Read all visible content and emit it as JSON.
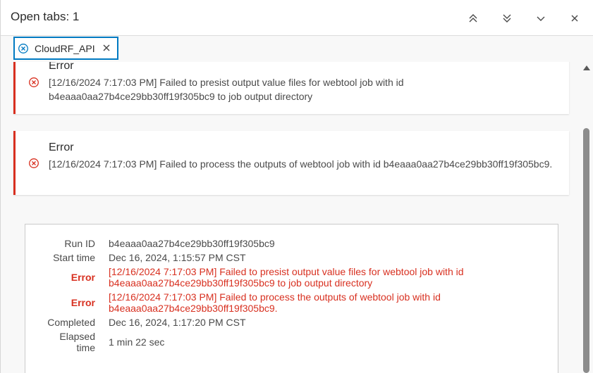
{
  "header": {
    "title": "Open tabs: 1",
    "buttons": [
      "collapse-all",
      "expand-all",
      "collapse",
      "close"
    ]
  },
  "tabs": [
    {
      "label": "CloudRF_API"
    }
  ],
  "messages": [
    {
      "type": "Error",
      "title": "Error",
      "text": "[12/16/2024 7:17:03 PM] Failed to presist output value files for webtool job with id b4eaaa0aa27b4ce29bb30ff19f305bc9 to job output directory"
    },
    {
      "type": "Error",
      "title": "Error",
      "text": "[12/16/2024 7:17:03 PM] Failed to process the outputs of webtool job with id b4eaaa0aa27b4ce29bb30ff19f305bc9."
    }
  ],
  "summary": {
    "run_id_label": "Run ID",
    "run_id": "b4eaaa0aa27b4ce29bb30ff19f305bc9",
    "start_time_label": "Start time",
    "start_time": "Dec 16, 2024, 1:15:57 PM CST",
    "error_label": "Error",
    "error1": "[12/16/2024 7:17:03 PM] Failed to presist output value files for webtool job with id b4eaaa0aa27b4ce29bb30ff19f305bc9 to job output directory",
    "error2": "[12/16/2024 7:17:03 PM] Failed to process the outputs of webtool job with id b4eaaa0aa27b4ce29bb30ff19f305bc9.",
    "completed_label": "Completed",
    "completed": "Dec 16, 2024, 1:17:20 PM CST",
    "elapsed_label": "Elapsed time",
    "elapsed": "1 min 22 sec"
  },
  "colors": {
    "accent": "#007ac2",
    "error": "#d83020"
  }
}
